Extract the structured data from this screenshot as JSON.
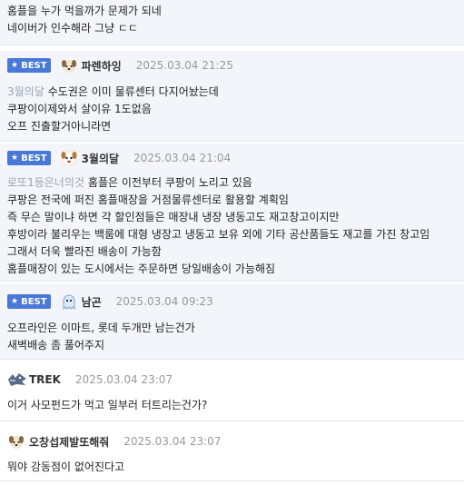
{
  "top_comment": {
    "lines": [
      "홈플을 누가 먹을까가 문제가 되네",
      "네이버가 인수해라 그냥 ㄷㄷ"
    ]
  },
  "comments": [
    {
      "best": true,
      "badge": "BEST",
      "avatar_icon": "puppy-avatar-icon",
      "nickname": "파렌하잉",
      "date": "2025.03.04 21:25",
      "reply_to": "3월의달",
      "lines": [
        "수도권은 이미 물류센터 다지어놨는데",
        "쿠팡이이제와서 살이유 1도없음",
        "오프 진출할거아니라면"
      ]
    },
    {
      "best": true,
      "badge": "BEST",
      "avatar_icon": "dog-face-avatar-icon",
      "nickname": "3월의달",
      "date": "2025.03.04 21:04",
      "reply_to": "로또1등은너의것",
      "lines": [
        "홈플은 이전부터 쿠팡이 노리고 있음",
        "쿠팡은 전국에 퍼진 홈플매장을 거점물류센터로 활용할 계획임",
        "즉 무슨 말이냐 하면 각 할인점들은 매장내 냉장 냉동고도 재고창고이지만",
        "후방이라 불리우는 백룸에 대형 냉장고 냉동고 보유 외에 기타 공산품들도 재고를 가진 창고임",
        "그래서 더욱 빨라진 배송이 가능함",
        "홈플매장이 있는 도시에서는 주문하면 당일배송이 가능해짐"
      ]
    },
    {
      "best": true,
      "badge": "BEST",
      "avatar_icon": "ghost-avatar-icon",
      "nickname": "남곤",
      "date": "2025.03.04 09:23",
      "reply_to": "",
      "lines": [
        "오프라인은 이마트, 롯데 두개만 남는건가",
        "새벽배송 좀 풀어주지"
      ]
    },
    {
      "best": false,
      "badge": "",
      "avatar_icon": "wolf-avatar-icon",
      "nickname": "TREK",
      "date": "2025.03.04 23:07",
      "reply_to": "",
      "lines": [
        "이거 사모펀드가 먹고 일부러 터트리는건가?"
      ]
    },
    {
      "best": false,
      "badge": "",
      "avatar_icon": "puppy-avatar-icon",
      "nickname": "오창섭제발또해줘",
      "date": "2025.03.04 23:07",
      "reply_to": "",
      "lines": [
        "뭐야 강동점이 없어진다고"
      ]
    }
  ],
  "colors": {
    "best_badge": "#4a78d8",
    "best_bg": "#f3f5fa",
    "reply_to": "#9aa3b2",
    "date": "#999999"
  }
}
